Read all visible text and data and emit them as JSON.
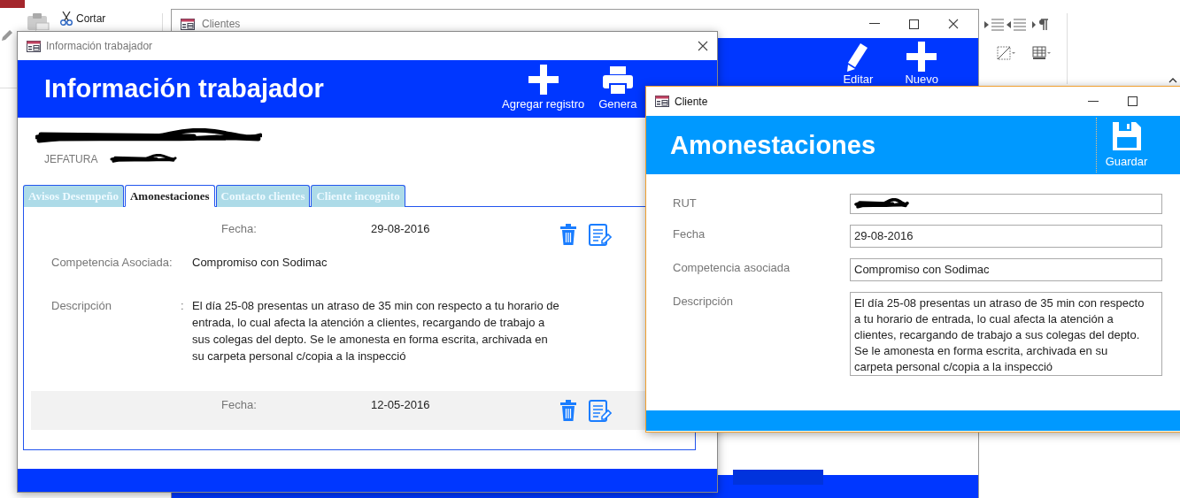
{
  "ribbon": {
    "cut_label": "Cortar"
  },
  "clientes_window": {
    "title": "Clientes",
    "toolbar": [
      {
        "label": "Editar",
        "kind": "edit"
      },
      {
        "label": "Nuevo",
        "kind": "add"
      }
    ]
  },
  "worker_window": {
    "title": "Información trabajador",
    "heading": "Información trabajador",
    "toolbar": [
      {
        "label": "Agregar registro",
        "kind": "add"
      },
      {
        "label": "Genera",
        "kind": "print"
      }
    ],
    "employee": {
      "name_redacted": true,
      "role_label": "JEFATURA",
      "role_redacted": true
    },
    "tabs": [
      {
        "label": "Avisos Desempeño",
        "selected": false
      },
      {
        "label": "Amonestaciones",
        "selected": true
      },
      {
        "label": "Contacto clientes",
        "selected": false
      },
      {
        "label": "Cliente incognito",
        "selected": false
      }
    ],
    "records": [
      {
        "date_label": "Fecha:",
        "date": "29-08-2016",
        "highlighted": false,
        "fields": [
          {
            "label": "Competencia Asociada:",
            "value": "Compromiso con Sodimac"
          },
          {
            "label": "Descripción",
            "separator": ":",
            "value": "El día 25-08 presentas un atraso de 35 min con respecto a tu horario de entrada, lo cual afecta la atención a clientes, recargando de trabajo a sus colegas del depto. Se le amonesta en forma escrita, archivada en su carpeta personal c/copia a la inspecció"
          }
        ]
      },
      {
        "date_label": "Fecha:",
        "date": "12-05-2016",
        "highlighted": true
      }
    ]
  },
  "cliente_window": {
    "title": "Cliente",
    "heading": "Amonestaciones",
    "save_label": "Guardar",
    "fields": [
      {
        "label": "RUT",
        "redacted": true
      },
      {
        "label": "Fecha",
        "value": "29-08-2016"
      },
      {
        "label": "Competencia asociada",
        "value": "Compromiso con Sodimac"
      },
      {
        "label": "Descripción",
        "value": "El día 25-08 presentas un atraso de 35 min con respecto a tu horario de entrada, lo cual afecta la atención a clientes, recargando de trabajo a sus colegas del depto. Se le amonesta en forma escrita, archivada en su carpeta personal c/copia a la inspecció",
        "multiline": true
      }
    ]
  }
}
